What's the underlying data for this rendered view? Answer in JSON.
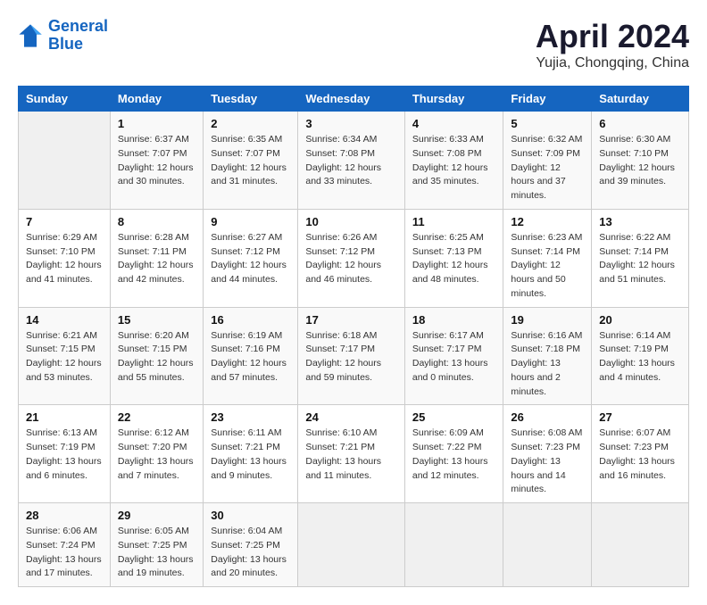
{
  "logo": {
    "line1": "General",
    "line2": "Blue"
  },
  "title": "April 2024",
  "subtitle": "Yujia, Chongqing, China",
  "days_of_week": [
    "Sunday",
    "Monday",
    "Tuesday",
    "Wednesday",
    "Thursday",
    "Friday",
    "Saturday"
  ],
  "weeks": [
    [
      {
        "num": "",
        "sunrise": "",
        "sunset": "",
        "daylight": ""
      },
      {
        "num": "1",
        "sunrise": "Sunrise: 6:37 AM",
        "sunset": "Sunset: 7:07 PM",
        "daylight": "Daylight: 12 hours and 30 minutes."
      },
      {
        "num": "2",
        "sunrise": "Sunrise: 6:35 AM",
        "sunset": "Sunset: 7:07 PM",
        "daylight": "Daylight: 12 hours and 31 minutes."
      },
      {
        "num": "3",
        "sunrise": "Sunrise: 6:34 AM",
        "sunset": "Sunset: 7:08 PM",
        "daylight": "Daylight: 12 hours and 33 minutes."
      },
      {
        "num": "4",
        "sunrise": "Sunrise: 6:33 AM",
        "sunset": "Sunset: 7:08 PM",
        "daylight": "Daylight: 12 hours and 35 minutes."
      },
      {
        "num": "5",
        "sunrise": "Sunrise: 6:32 AM",
        "sunset": "Sunset: 7:09 PM",
        "daylight": "Daylight: 12 hours and 37 minutes."
      },
      {
        "num": "6",
        "sunrise": "Sunrise: 6:30 AM",
        "sunset": "Sunset: 7:10 PM",
        "daylight": "Daylight: 12 hours and 39 minutes."
      }
    ],
    [
      {
        "num": "7",
        "sunrise": "Sunrise: 6:29 AM",
        "sunset": "Sunset: 7:10 PM",
        "daylight": "Daylight: 12 hours and 41 minutes."
      },
      {
        "num": "8",
        "sunrise": "Sunrise: 6:28 AM",
        "sunset": "Sunset: 7:11 PM",
        "daylight": "Daylight: 12 hours and 42 minutes."
      },
      {
        "num": "9",
        "sunrise": "Sunrise: 6:27 AM",
        "sunset": "Sunset: 7:12 PM",
        "daylight": "Daylight: 12 hours and 44 minutes."
      },
      {
        "num": "10",
        "sunrise": "Sunrise: 6:26 AM",
        "sunset": "Sunset: 7:12 PM",
        "daylight": "Daylight: 12 hours and 46 minutes."
      },
      {
        "num": "11",
        "sunrise": "Sunrise: 6:25 AM",
        "sunset": "Sunset: 7:13 PM",
        "daylight": "Daylight: 12 hours and 48 minutes."
      },
      {
        "num": "12",
        "sunrise": "Sunrise: 6:23 AM",
        "sunset": "Sunset: 7:14 PM",
        "daylight": "Daylight: 12 hours and 50 minutes."
      },
      {
        "num": "13",
        "sunrise": "Sunrise: 6:22 AM",
        "sunset": "Sunset: 7:14 PM",
        "daylight": "Daylight: 12 hours and 51 minutes."
      }
    ],
    [
      {
        "num": "14",
        "sunrise": "Sunrise: 6:21 AM",
        "sunset": "Sunset: 7:15 PM",
        "daylight": "Daylight: 12 hours and 53 minutes."
      },
      {
        "num": "15",
        "sunrise": "Sunrise: 6:20 AM",
        "sunset": "Sunset: 7:15 PM",
        "daylight": "Daylight: 12 hours and 55 minutes."
      },
      {
        "num": "16",
        "sunrise": "Sunrise: 6:19 AM",
        "sunset": "Sunset: 7:16 PM",
        "daylight": "Daylight: 12 hours and 57 minutes."
      },
      {
        "num": "17",
        "sunrise": "Sunrise: 6:18 AM",
        "sunset": "Sunset: 7:17 PM",
        "daylight": "Daylight: 12 hours and 59 minutes."
      },
      {
        "num": "18",
        "sunrise": "Sunrise: 6:17 AM",
        "sunset": "Sunset: 7:17 PM",
        "daylight": "Daylight: 13 hours and 0 minutes."
      },
      {
        "num": "19",
        "sunrise": "Sunrise: 6:16 AM",
        "sunset": "Sunset: 7:18 PM",
        "daylight": "Daylight: 13 hours and 2 minutes."
      },
      {
        "num": "20",
        "sunrise": "Sunrise: 6:14 AM",
        "sunset": "Sunset: 7:19 PM",
        "daylight": "Daylight: 13 hours and 4 minutes."
      }
    ],
    [
      {
        "num": "21",
        "sunrise": "Sunrise: 6:13 AM",
        "sunset": "Sunset: 7:19 PM",
        "daylight": "Daylight: 13 hours and 6 minutes."
      },
      {
        "num": "22",
        "sunrise": "Sunrise: 6:12 AM",
        "sunset": "Sunset: 7:20 PM",
        "daylight": "Daylight: 13 hours and 7 minutes."
      },
      {
        "num": "23",
        "sunrise": "Sunrise: 6:11 AM",
        "sunset": "Sunset: 7:21 PM",
        "daylight": "Daylight: 13 hours and 9 minutes."
      },
      {
        "num": "24",
        "sunrise": "Sunrise: 6:10 AM",
        "sunset": "Sunset: 7:21 PM",
        "daylight": "Daylight: 13 hours and 11 minutes."
      },
      {
        "num": "25",
        "sunrise": "Sunrise: 6:09 AM",
        "sunset": "Sunset: 7:22 PM",
        "daylight": "Daylight: 13 hours and 12 minutes."
      },
      {
        "num": "26",
        "sunrise": "Sunrise: 6:08 AM",
        "sunset": "Sunset: 7:23 PM",
        "daylight": "Daylight: 13 hours and 14 minutes."
      },
      {
        "num": "27",
        "sunrise": "Sunrise: 6:07 AM",
        "sunset": "Sunset: 7:23 PM",
        "daylight": "Daylight: 13 hours and 16 minutes."
      }
    ],
    [
      {
        "num": "28",
        "sunrise": "Sunrise: 6:06 AM",
        "sunset": "Sunset: 7:24 PM",
        "daylight": "Daylight: 13 hours and 17 minutes."
      },
      {
        "num": "29",
        "sunrise": "Sunrise: 6:05 AM",
        "sunset": "Sunset: 7:25 PM",
        "daylight": "Daylight: 13 hours and 19 minutes."
      },
      {
        "num": "30",
        "sunrise": "Sunrise: 6:04 AM",
        "sunset": "Sunset: 7:25 PM",
        "daylight": "Daylight: 13 hours and 20 minutes."
      },
      {
        "num": "",
        "sunrise": "",
        "sunset": "",
        "daylight": ""
      },
      {
        "num": "",
        "sunrise": "",
        "sunset": "",
        "daylight": ""
      },
      {
        "num": "",
        "sunrise": "",
        "sunset": "",
        "daylight": ""
      },
      {
        "num": "",
        "sunrise": "",
        "sunset": "",
        "daylight": ""
      }
    ]
  ]
}
